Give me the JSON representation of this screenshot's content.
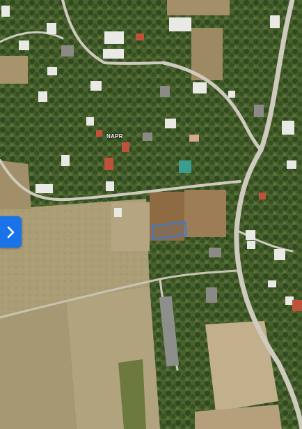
{
  "map": {
    "view": "satellite",
    "label": "NAPR",
    "selected_parcel_color": "#2f7ee8",
    "colors": {
      "vegetation": "#3f5a2a",
      "dry_field": "#a89a72",
      "road": "#c9c6bd",
      "roof": "#e6e6e6"
    }
  },
  "controls": {
    "expand_panel": {
      "icon": "chevron-right-icon",
      "color": "#1a73e8"
    }
  }
}
